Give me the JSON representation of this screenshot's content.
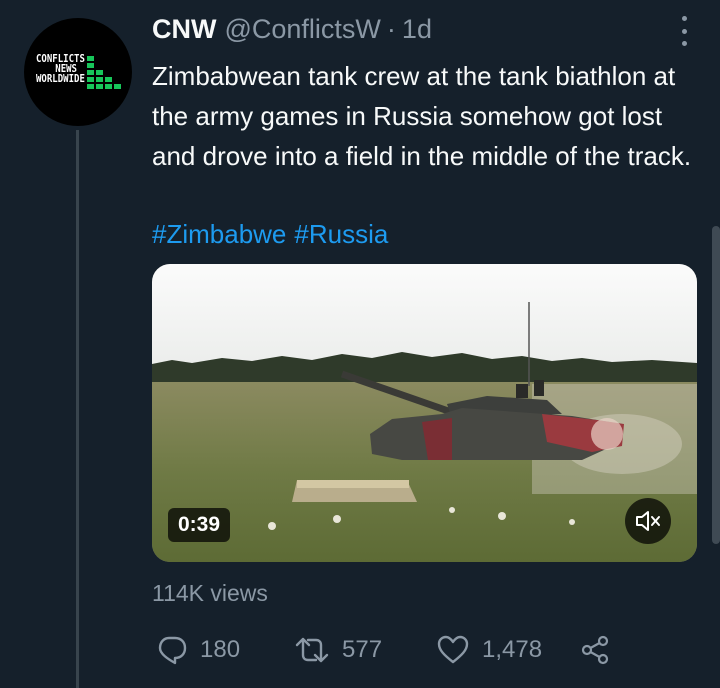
{
  "account": {
    "name": "CNW",
    "handle": "@ConflictsW",
    "separator": "·",
    "time": "1d",
    "avatar_logo": [
      "CONFLICTS",
      "NEWS",
      "WORLDWIDE"
    ]
  },
  "tweet": {
    "text": "Zimbabwean tank crew at the tank biathlon at the army games in Russia somehow got lost and drove into a field in the middle of the track.",
    "hashtags": [
      "#Zimbabwe",
      "#Russia"
    ]
  },
  "video": {
    "duration": "0:39",
    "mute_icon": "speaker-muted-icon"
  },
  "stats": {
    "views": "114K views"
  },
  "actions": {
    "reply_count": "180",
    "retweet_count": "577",
    "like_count": "1,478",
    "share_icon": "share-icon"
  },
  "colors": {
    "background": "#15202b",
    "text": "#f7f9f9",
    "secondary": "#8b98a5",
    "link": "#1d9bf0",
    "logo_green": "#17c65a"
  }
}
